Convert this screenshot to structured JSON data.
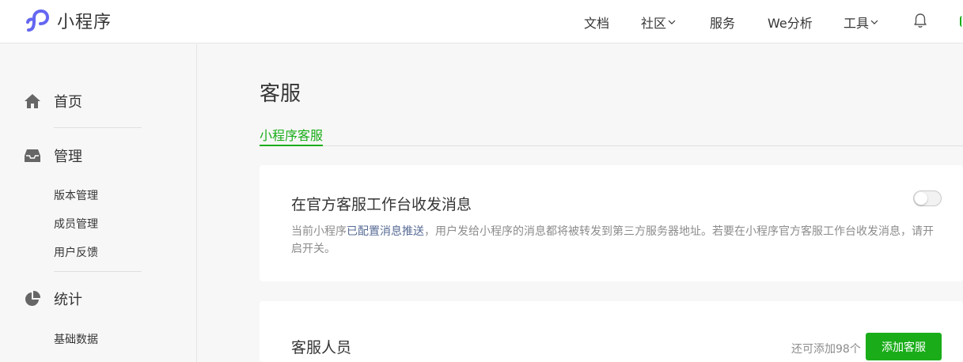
{
  "brand": {
    "name": "小程序",
    "accent": "#1aad19",
    "logo_color": "#6467f0"
  },
  "nav": {
    "docs": "文档",
    "community": "社区",
    "services": "服务",
    "analytics": "We分析",
    "tools": "工具"
  },
  "sidebar": {
    "home": "首页",
    "manage": "管理",
    "manage_items": [
      "版本管理",
      "成员管理",
      "用户反馈"
    ],
    "stats": "统计",
    "stats_items": [
      "基础数据"
    ]
  },
  "main": {
    "title": "客服",
    "tab": "小程序客服",
    "workbench": {
      "title": "在官方客服工作台收发消息",
      "desc_pre": "当前小程序",
      "desc_link": "已配置消息推送",
      "desc_post": "，用户发给小程序的消息都将被转发到第三方服务器地址。若要在小程序官方客服工作台收发消息，请开启开关。",
      "toggle_on": false
    },
    "staff": {
      "title": "客服人员",
      "remaining": "还可添加98个",
      "add_button": "添加客服"
    }
  }
}
